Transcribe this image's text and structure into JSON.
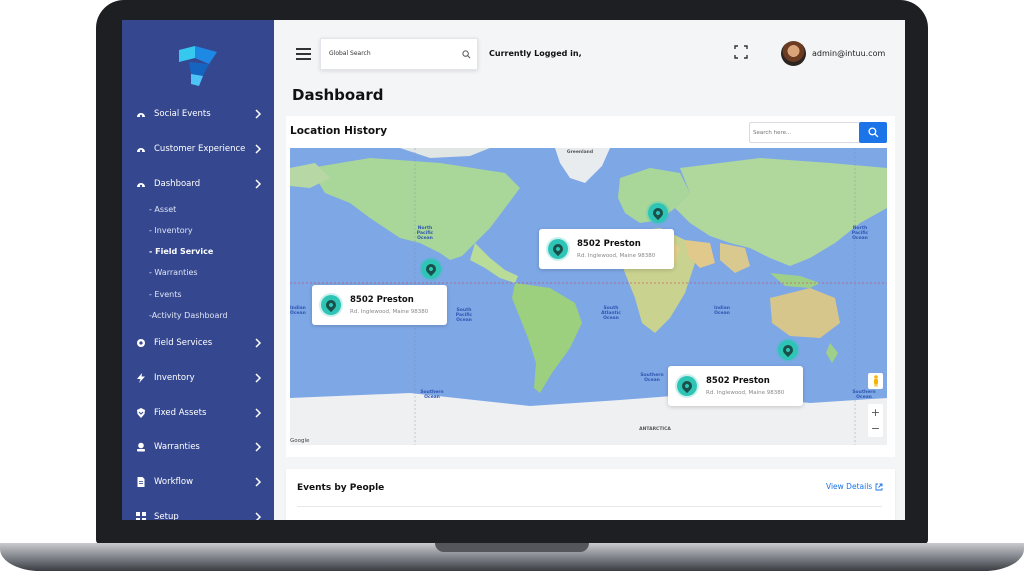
{
  "sidebar": {
    "items": [
      {
        "label": "Social Events",
        "icon": "dashboard-gauge-icon"
      },
      {
        "label": "Customer Experience",
        "icon": "dashboard-gauge-icon"
      },
      {
        "label": "Dashboard",
        "icon": "dashboard-gauge-icon"
      },
      {
        "label": "Field Services",
        "icon": "gear-icon"
      },
      {
        "label": "Inventory",
        "icon": "lightning-icon"
      },
      {
        "label": "Fixed Assets",
        "icon": "shield-icon"
      },
      {
        "label": "Warranties",
        "icon": "user-badge-icon"
      },
      {
        "label": "Workflow",
        "icon": "document-icon"
      },
      {
        "label": "Setup",
        "icon": "grid-icon"
      }
    ],
    "dashboard_subitems": [
      {
        "label": "- Asset",
        "active": false
      },
      {
        "label": "- Inventory",
        "active": false
      },
      {
        "label": "- Field Service",
        "active": true
      },
      {
        "label": "- Warranties",
        "active": false
      },
      {
        "label": "- Events",
        "active": false
      },
      {
        "label": "-Activity Dashboard",
        "active": false
      }
    ]
  },
  "topbar": {
    "search_placeholder": "Global Search",
    "logged_in_text": "Currently Logged in,",
    "user_email": "admin@intuu.com"
  },
  "page": {
    "title": "Dashboard"
  },
  "location_history": {
    "title": "Location History",
    "search_placeholder": "Search here...",
    "popups": [
      {
        "title": "8502 Preston",
        "subtitle": "Rd. Inglewood, Maine 98380"
      },
      {
        "title": "8502 Preston",
        "subtitle": "Rd. Inglewood, Maine 98380"
      },
      {
        "title": "8502 Preston",
        "subtitle": "Rd. Inglewood, Maine 98380"
      }
    ],
    "map_labels": {
      "greenland": "Greenland",
      "north_pacific_1": "North Pacific Ocean",
      "north_pacific_2": "North Pacific Ocean",
      "south_pacific": "South Pacific Ocean",
      "south_atlantic": "South Atlantic Ocean",
      "indian": "Indian Ocean",
      "indian_2": "Indian Ocean",
      "southern_1": "Southern Ocean",
      "southern_2": "Southern Ocean",
      "southern_3": "Southern Ocean",
      "antarctica": "ANTARCTICA"
    },
    "google_brand": "Google",
    "zoom_in": "+",
    "zoom_out": "−"
  },
  "events": {
    "title": "Events by People",
    "view_details": "View Details"
  },
  "colors": {
    "sidebar": "#35488f",
    "accent": "#1b74e8",
    "pin": "#2ec4b6",
    "ocean": "#7ea7e6",
    "land": "#a9d79a"
  }
}
